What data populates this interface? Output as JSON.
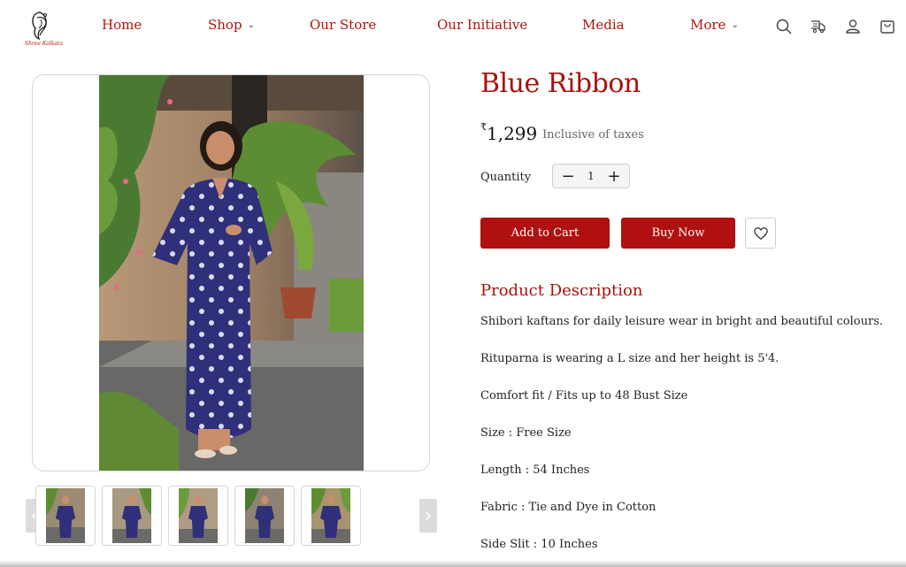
{
  "brand": {
    "logo_text": "Shree Kolkata"
  },
  "nav": {
    "items": [
      {
        "label": "Home",
        "has_dropdown": false
      },
      {
        "label": "Shop",
        "has_dropdown": true
      },
      {
        "label": "Our Store",
        "has_dropdown": false
      },
      {
        "label": "Our Initiative",
        "has_dropdown": false
      },
      {
        "label": "Media",
        "has_dropdown": false
      },
      {
        "label": "More",
        "has_dropdown": true
      }
    ],
    "chevron": "⌄",
    "icons": [
      "search-icon",
      "delivery-icon",
      "user-icon",
      "cart-icon"
    ]
  },
  "gallery": {
    "prev_arrow": "‹",
    "next_arrow": "›",
    "thumbnail_count": 5
  },
  "product": {
    "title": "Blue Ribbon",
    "currency": "₹",
    "price": "1,299",
    "tax_note": "Inclusive of taxes",
    "quantity_label": "Quantity",
    "quantity": "1",
    "minus": "−",
    "plus": "+",
    "add_to_cart": "Add to Cart",
    "buy_now": "Buy Now"
  },
  "description": {
    "title": "Product Description",
    "lines": [
      "Shibori kaftans for daily leisure wear in bright and beautiful colours.",
      "Rituparna is wearing a L size and her height is 5'4.",
      "Comfort fit / Fits up to 48 Bust Size",
      "Size : Free Size",
      "Length : 54 Inches",
      "Fabric : Tie and Dye in Cotton",
      "Side Slit : 10 Inches"
    ]
  },
  "colors": {
    "brand_red": "#b01010",
    "title_red": "#a9130c",
    "dress_blue": "#2f2f7a"
  }
}
